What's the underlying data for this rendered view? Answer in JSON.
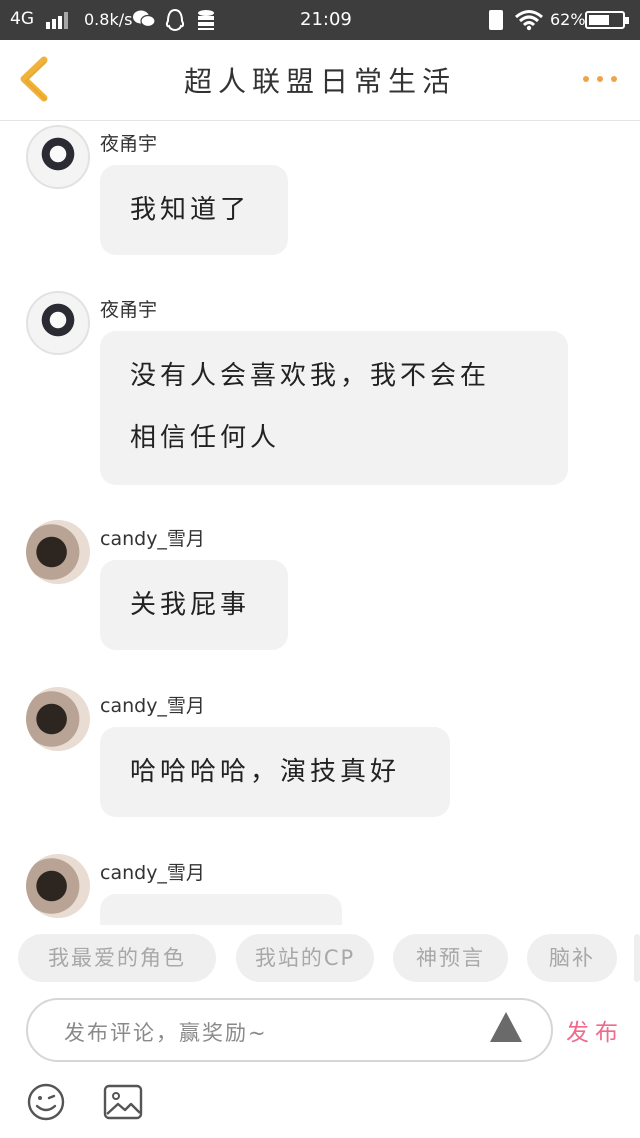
{
  "status_bar": {
    "network": "4G",
    "speed": "0.8k/s",
    "time": "21:09",
    "battery_percent": "62%",
    "battery_level": 0.62
  },
  "header": {
    "title": "超人联盟日常生活",
    "accent_color": "#f0a248"
  },
  "messages": [
    {
      "author": "夜甬宇",
      "lines": [
        "我知道了"
      ],
      "avatar": "avatar-boy"
    },
    {
      "author": "夜甬宇",
      "lines": [
        "没有人会喜欢我，我不会在",
        "相信任何人"
      ],
      "avatar": "avatar-boy"
    },
    {
      "author": "candy_雪月",
      "lines": [
        "关我屁事"
      ],
      "avatar": "avatar-girl"
    },
    {
      "author": "candy_雪月",
      "lines": [
        "哈哈哈哈，演技真好"
      ],
      "avatar": "avatar-girl"
    },
    {
      "author": "candy_雪月",
      "lines": [
        ""
      ],
      "avatar": "avatar-girl"
    }
  ],
  "tags": [
    "我最爱的角色",
    "我站的CP",
    "神预言",
    "脑补"
  ],
  "comment": {
    "placeholder": "发布评论，赢奖励~",
    "publish_label": "发布",
    "publish_color": "#f06a8c"
  },
  "icons": {
    "back": "chevron-left-icon",
    "more": "more-dots-icon",
    "emoji": "smiley-icon",
    "image": "image-icon",
    "send": "triangle-icon"
  }
}
